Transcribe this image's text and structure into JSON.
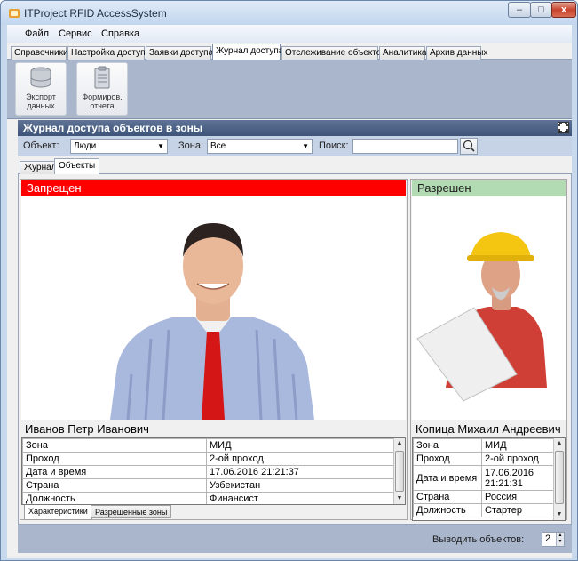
{
  "window": {
    "title": "ITProject RFID AccessSystem",
    "minimize": "–",
    "maximize": "□",
    "close": "x"
  },
  "menu": [
    "Файл",
    "Сервис",
    "Справка"
  ],
  "tabs": [
    {
      "label": "Справочники",
      "active": false
    },
    {
      "label": "Настройка доступа",
      "active": false
    },
    {
      "label": "Заявки доступа",
      "active": false
    },
    {
      "label": "Журнал доступа",
      "active": true
    },
    {
      "label": "Отслеживание объектов",
      "active": false
    },
    {
      "label": "Аналитика",
      "active": false
    },
    {
      "label": "Архив данных",
      "active": false
    }
  ],
  "toolbar": {
    "export_label": "Экспорт данных",
    "report_label": "Формиров. отчета"
  },
  "panel": {
    "title": "Журнал доступа объектов в зоны"
  },
  "filters": {
    "object_label": "Объект:",
    "object_value": "Люди",
    "zone_label": "Зона:",
    "zone_value": "Все",
    "search_label": "Поиск:",
    "search_value": ""
  },
  "subtabs": [
    {
      "label": "Журнал",
      "active": false
    },
    {
      "label": "Объекты",
      "active": true
    }
  ],
  "cards": [
    {
      "status": "Запрещен",
      "status_color": "#ff0000",
      "name": "Иванов Петр Иванович",
      "rows": [
        {
          "key": "Зона",
          "value": "МИД"
        },
        {
          "key": "Проход",
          "value": "2-ой проход"
        },
        {
          "key": "Дата и время",
          "value": "17.06.2016 21:21:37"
        },
        {
          "key": "Страна",
          "value": "Узбекистан"
        },
        {
          "key": "Должность",
          "value": "Финансист"
        }
      ],
      "bottom_tabs": [
        "Характеристики",
        "Разрешенные зоны"
      ]
    },
    {
      "status": "Разрешен",
      "status_color": "#b3dbb3",
      "name": "Копица Михаил Андреевич",
      "rows": [
        {
          "key": "Зона",
          "value": "МИД"
        },
        {
          "key": "Проход",
          "value": "2-ой проход"
        },
        {
          "key": "Дата и время",
          "value": "17.06.2016 21:21:31"
        },
        {
          "key": "Страна",
          "value": "Россия"
        },
        {
          "key": "Должность",
          "value": "Стартер"
        }
      ]
    }
  ],
  "footer": {
    "count_label": "Выводить объектов:",
    "count_value": "2"
  }
}
